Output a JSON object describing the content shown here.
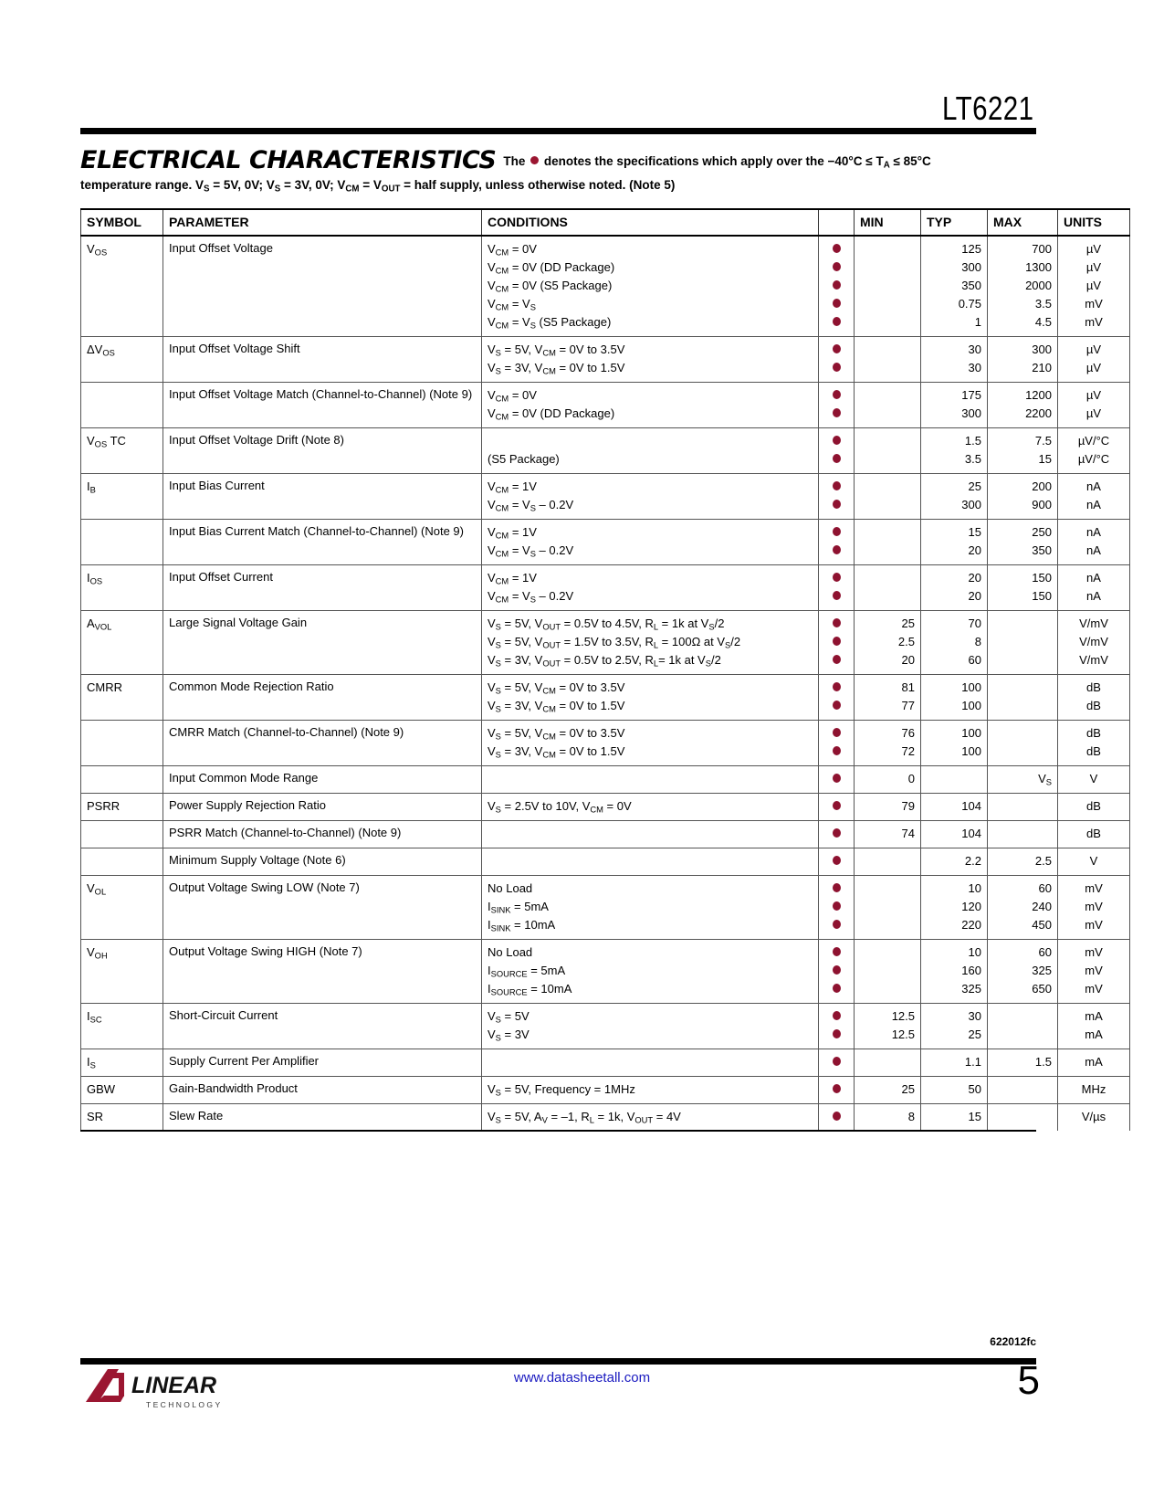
{
  "header": {
    "part_number": "LT6221"
  },
  "section": {
    "title": "ELECTRICAL CHARACTERISTICS",
    "note_prefix": "The",
    "note_line1_a": "denotes the specifications which apply over the −40°C ≤ T",
    "note_line1_sub": "A",
    "note_line1_b": " ≤ 85°C",
    "note_line2": "temperature range. V_S = 5V, 0V; V_S = 3V, 0V; V_CM = V_OUT = half supply, unless otherwise noted. (Note 5)"
  },
  "table": {
    "columns": {
      "symbol": "SYMBOL",
      "parameter": "PARAMETER",
      "conditions": "CONDITIONS",
      "min": "MIN",
      "typ": "TYP",
      "max": "MAX",
      "units": "UNITS"
    },
    "rows": [
      {
        "group": true,
        "symbol_html": "V<sub>OS</sub>",
        "parameter": "Input Offset Voltage",
        "lines": [
          {
            "cond_html": "V<sub>CM</sub> = 0V",
            "dot": true,
            "min": "",
            "typ": "125",
            "max": "700",
            "unit_html": "µV"
          },
          {
            "cond_html": "V<sub>CM</sub> = 0V (DD Package)",
            "dot": true,
            "min": "",
            "typ": "300",
            "max": "1300",
            "unit_html": "µV"
          },
          {
            "cond_html": "V<sub>CM</sub> = 0V (S5 Package)",
            "dot": true,
            "min": "",
            "typ": "350",
            "max": "2000",
            "unit_html": "µV"
          },
          {
            "cond_html": "V<sub>CM</sub> = V<sub>S</sub>",
            "dot": true,
            "min": "",
            "typ": "0.75",
            "max": "3.5",
            "unit_html": "mV"
          },
          {
            "cond_html": "V<sub>CM</sub> = V<sub>S</sub> (S5 Package)",
            "dot": true,
            "min": "",
            "typ": "1",
            "max": "4.5",
            "unit_html": "mV"
          }
        ]
      },
      {
        "group": true,
        "symbol_html": "ΔV<sub>OS</sub>",
        "parameter": "Input Offset Voltage Shift",
        "lines": [
          {
            "cond_html": "V<sub>S</sub> = 5V, V<sub>CM</sub> = 0V to 3.5V",
            "dot": true,
            "min": "",
            "typ": "30",
            "max": "300",
            "unit_html": "µV"
          },
          {
            "cond_html": "V<sub>S</sub> = 3V, V<sub>CM</sub> = 0V to 1.5V",
            "dot": true,
            "min": "",
            "typ": "30",
            "max": "210",
            "unit_html": "µV"
          }
        ]
      },
      {
        "group": true,
        "symbol_html": "",
        "parameter": "Input Offset Voltage Match (Channel-to-Channel) (Note 9)",
        "lines": [
          {
            "cond_html": "V<sub>CM</sub> = 0V",
            "dot": true,
            "min": "",
            "typ": "175",
            "max": "1200",
            "unit_html": "µV"
          },
          {
            "cond_html": "V<sub>CM</sub> = 0V (DD Package)",
            "dot": true,
            "min": "",
            "typ": "300",
            "max": "2200",
            "unit_html": "µV"
          }
        ]
      },
      {
        "group": true,
        "symbol_html": "V<sub>OS</sub> TC",
        "parameter": "Input Offset Voltage Drift (Note 8)",
        "lines": [
          {
            "cond_html": "",
            "dot": true,
            "min": "",
            "typ": "1.5",
            "max": "7.5",
            "unit_html": "µV/°C"
          },
          {
            "cond_html": "(S5 Package)",
            "dot": true,
            "min": "",
            "typ": "3.5",
            "max": "15",
            "unit_html": "µV/°C"
          }
        ]
      },
      {
        "group": true,
        "symbol_html": "I<sub>B</sub>",
        "parameter": "Input Bias Current",
        "lines": [
          {
            "cond_html": "V<sub>CM</sub> = 1V",
            "dot": true,
            "min": "",
            "typ": "25",
            "max": "200",
            "unit_html": "nA"
          },
          {
            "cond_html": "V<sub>CM</sub> = V<sub>S</sub> – 0.2V",
            "dot": true,
            "min": "",
            "typ": "300",
            "max": "900",
            "unit_html": "nA"
          }
        ]
      },
      {
        "group": true,
        "symbol_html": "",
        "parameter": "Input Bias Current Match (Channel-to-Channel) (Note 9)",
        "lines": [
          {
            "cond_html": "V<sub>CM</sub> = 1V",
            "dot": true,
            "min": "",
            "typ": "15",
            "max": "250",
            "unit_html": "nA"
          },
          {
            "cond_html": "V<sub>CM</sub> = V<sub>S</sub> – 0.2V",
            "dot": true,
            "min": "",
            "typ": "20",
            "max": "350",
            "unit_html": "nA"
          }
        ]
      },
      {
        "group": true,
        "symbol_html": "I<sub>OS</sub>",
        "parameter": "Input Offset Current",
        "lines": [
          {
            "cond_html": "V<sub>CM</sub> = 1V",
            "dot": true,
            "min": "",
            "typ": "20",
            "max": "150",
            "unit_html": "nA"
          },
          {
            "cond_html": "V<sub>CM</sub> = V<sub>S</sub> – 0.2V",
            "dot": true,
            "min": "",
            "typ": "20",
            "max": "150",
            "unit_html": "nA"
          }
        ]
      },
      {
        "group": true,
        "symbol_html": "A<sub>VOL</sub>",
        "parameter": "Large Signal Voltage Gain",
        "lines": [
          {
            "cond_html": "V<sub>S</sub> = 5V, V<sub>OUT</sub> = 0.5V to 4.5V, R<sub>L</sub> = 1k at V<sub>S</sub>/2",
            "dot": true,
            "min": "25",
            "typ": "70",
            "max": "",
            "unit_html": "V/mV"
          },
          {
            "cond_html": "V<sub>S</sub> = 5V, V<sub>OUT</sub> = 1.5V to 3.5V, R<sub>L</sub> = 100Ω at V<sub>S</sub>/2",
            "dot": true,
            "min": "2.5",
            "typ": "8",
            "max": "",
            "unit_html": "V/mV"
          },
          {
            "cond_html": "V<sub>S</sub> = 3V, V<sub>OUT</sub> = 0.5V to 2.5V, R<sub>L</sub>= 1k at V<sub>S</sub>/2",
            "dot": true,
            "min": "20",
            "typ": "60",
            "max": "",
            "unit_html": "V/mV"
          }
        ]
      },
      {
        "group": true,
        "symbol_html": "CMRR",
        "parameter": "Common Mode Rejection Ratio",
        "lines": [
          {
            "cond_html": "V<sub>S</sub> = 5V, V<sub>CM</sub> = 0V to 3.5V",
            "dot": true,
            "min": "81",
            "typ": "100",
            "max": "",
            "unit_html": "dB"
          },
          {
            "cond_html": "V<sub>S</sub> = 3V, V<sub>CM</sub> = 0V to 1.5V",
            "dot": true,
            "min": "77",
            "typ": "100",
            "max": "",
            "unit_html": "dB"
          }
        ]
      },
      {
        "group": true,
        "symbol_html": "",
        "parameter": "CMRR Match (Channel-to-Channel) (Note 9)",
        "lines": [
          {
            "cond_html": "V<sub>S</sub> = 5V, V<sub>CM</sub> = 0V to 3.5V",
            "dot": true,
            "min": "76",
            "typ": "100",
            "max": "",
            "unit_html": "dB"
          },
          {
            "cond_html": "V<sub>S</sub> = 3V, V<sub>CM</sub> = 0V to 1.5V",
            "dot": true,
            "min": "72",
            "typ": "100",
            "max": "",
            "unit_html": "dB"
          }
        ]
      },
      {
        "group": true,
        "symbol_html": "",
        "parameter": "Input Common Mode Range",
        "lines": [
          {
            "cond_html": "",
            "dot": true,
            "min": "0",
            "typ": "",
            "max": "V<sub>S</sub>",
            "unit_html": "V"
          }
        ]
      },
      {
        "group": true,
        "symbol_html": "PSRR",
        "parameter": "Power Supply Rejection Ratio",
        "lines": [
          {
            "cond_html": "V<sub>S</sub> = 2.5V to 10V, V<sub>CM</sub> = 0V",
            "dot": true,
            "min": "79",
            "typ": "104",
            "max": "",
            "unit_html": "dB"
          }
        ]
      },
      {
        "group": false,
        "symbol_html": "",
        "parameter": "PSRR Match (Channel-to-Channel) (Note 9)",
        "lines": [
          {
            "cond_html": "",
            "dot": true,
            "min": "74",
            "typ": "104",
            "max": "",
            "unit_html": "dB"
          }
        ]
      },
      {
        "group": true,
        "symbol_html": "",
        "parameter": "Minimum Supply Voltage (Note 6)",
        "lines": [
          {
            "cond_html": "",
            "dot": true,
            "min": "",
            "typ": "2.2",
            "max": "2.5",
            "unit_html": "V"
          }
        ]
      },
      {
        "group": true,
        "symbol_html": "V<sub>OL</sub>",
        "parameter": "Output Voltage Swing LOW (Note 7)",
        "lines": [
          {
            "cond_html": "No Load",
            "dot": true,
            "min": "",
            "typ": "10",
            "max": "60",
            "unit_html": "mV"
          },
          {
            "cond_html": "I<sub>SINK</sub> = 5mA",
            "dot": true,
            "min": "",
            "typ": "120",
            "max": "240",
            "unit_html": "mV"
          },
          {
            "cond_html": "I<sub>SINK</sub> = 10mA",
            "dot": true,
            "min": "",
            "typ": "220",
            "max": "450",
            "unit_html": "mV"
          }
        ]
      },
      {
        "group": true,
        "symbol_html": "V<sub>OH</sub>",
        "parameter": "Output Voltage Swing HIGH (Note 7)",
        "lines": [
          {
            "cond_html": "No Load",
            "dot": true,
            "min": "",
            "typ": "10",
            "max": "60",
            "unit_html": "mV"
          },
          {
            "cond_html": "I<sub>SOURCE</sub> = 5mA",
            "dot": true,
            "min": "",
            "typ": "160",
            "max": "325",
            "unit_html": "mV"
          },
          {
            "cond_html": "I<sub>SOURCE</sub> = 10mA",
            "dot": true,
            "min": "",
            "typ": "325",
            "max": "650",
            "unit_html": "mV"
          }
        ]
      },
      {
        "group": true,
        "symbol_html": "I<sub>SC</sub>",
        "parameter": "Short-Circuit Current",
        "lines": [
          {
            "cond_html": "V<sub>S</sub> = 5V",
            "dot": true,
            "min": "12.5",
            "typ": "30",
            "max": "",
            "unit_html": "mA"
          },
          {
            "cond_html": "V<sub>S</sub> = 3V",
            "dot": true,
            "min": "12.5",
            "typ": "25",
            "max": "",
            "unit_html": "mA"
          }
        ]
      },
      {
        "group": true,
        "symbol_html": "I<sub>S</sub>",
        "parameter": "Supply Current Per Amplifier",
        "lines": [
          {
            "cond_html": "",
            "dot": true,
            "min": "",
            "typ": "1.1",
            "max": "1.5",
            "unit_html": "mA"
          }
        ]
      },
      {
        "group": true,
        "symbol_html": "GBW",
        "parameter": "Gain-Bandwidth Product",
        "lines": [
          {
            "cond_html": "V<sub>S</sub> = 5V, Frequency = 1MHz",
            "dot": true,
            "min": "25",
            "typ": "50",
            "max": "",
            "unit_html": "MHz"
          }
        ]
      },
      {
        "group": true,
        "symbol_html": "SR",
        "parameter": "Slew Rate",
        "lines": [
          {
            "cond_html": "V<sub>S</sub> = 5V, A<sub>V</sub> = –1, R<sub>L</sub> = 1k, V<sub>OUT</sub> = 4V",
            "dot": true,
            "min": "8",
            "typ": "15",
            "max": "",
            "unit_html": "V/µs"
          }
        ]
      }
    ]
  },
  "footer": {
    "doc_code": "622012fc",
    "url": "www.datasheetall.com",
    "page_number": "5",
    "logo_text": "LINEAR",
    "logo_sub": "TECHNOLOGY"
  }
}
